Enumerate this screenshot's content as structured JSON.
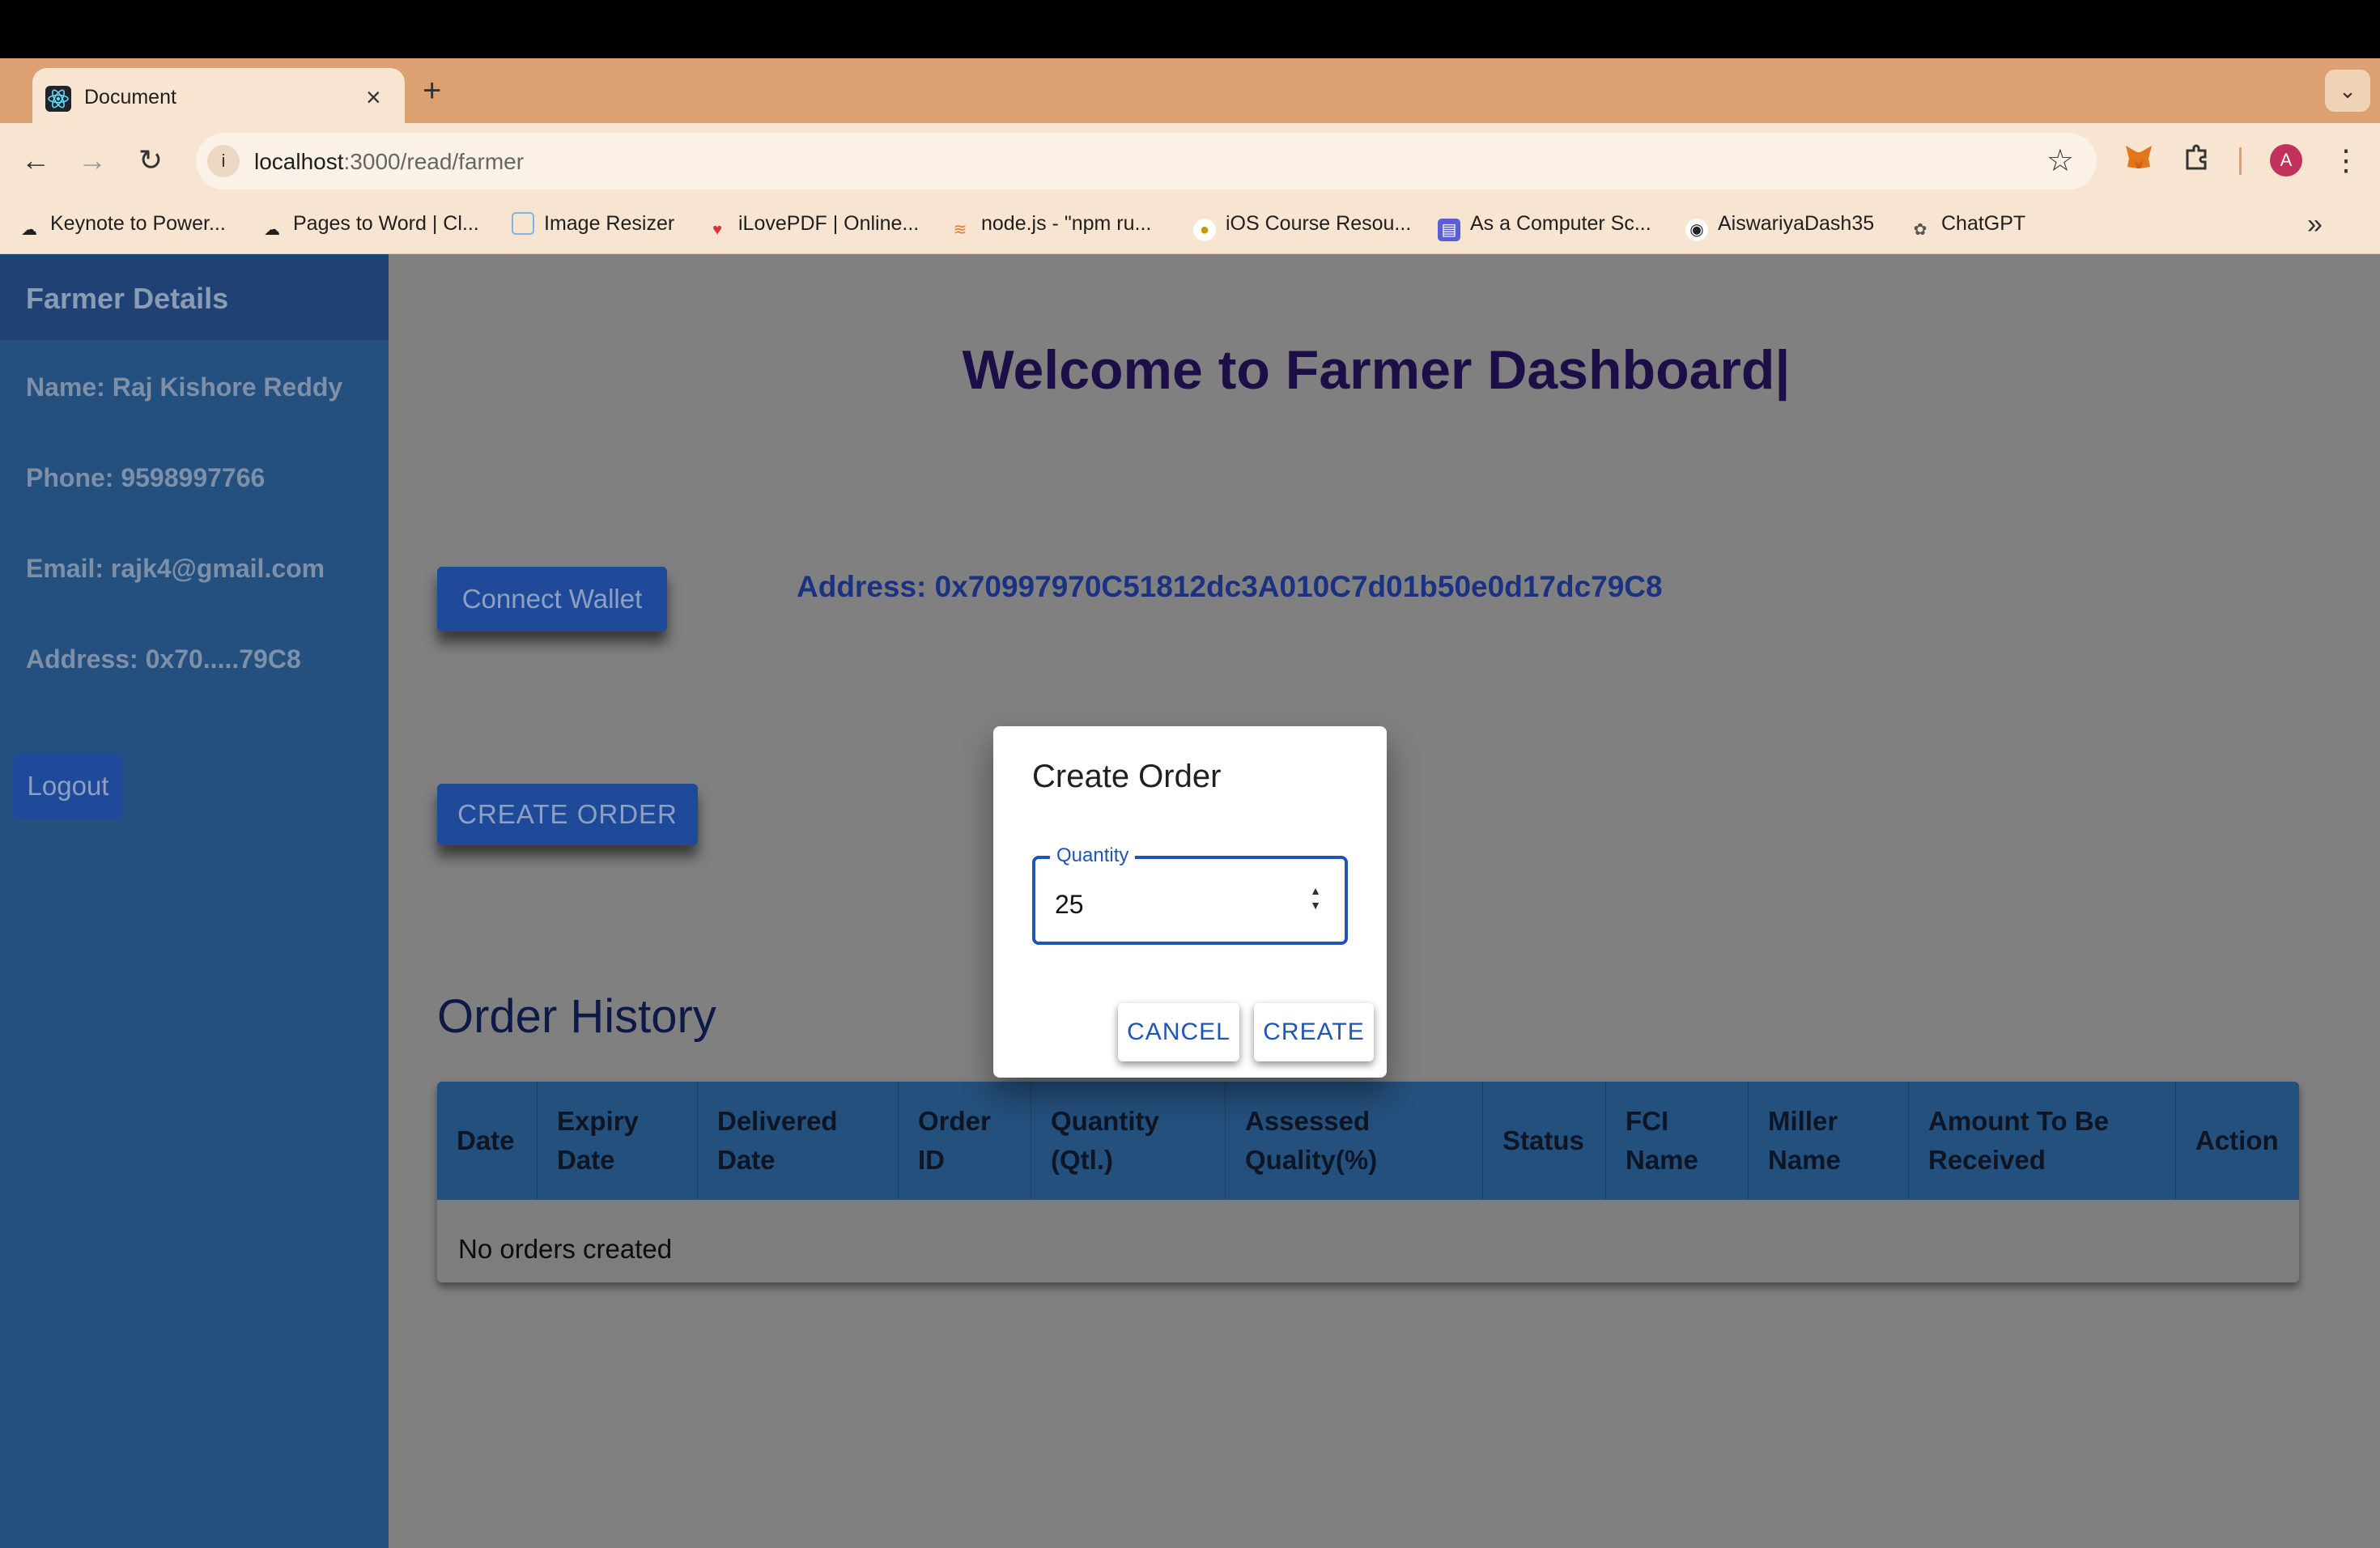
{
  "browser": {
    "tab_title": "Document",
    "url_host": "localhost",
    "url_path": ":3000/read/farmer",
    "bookmarks": [
      {
        "label": "Keynote to Power...",
        "icon": "cloud-icon"
      },
      {
        "label": "Pages to Word | Cl...",
        "icon": "cloud-icon"
      },
      {
        "label": "Image Resizer",
        "icon": "image-icon"
      },
      {
        "label": "iLovePDF | Online...",
        "icon": "heart-icon"
      },
      {
        "label": "node.js - \"npm ru...",
        "icon": "stackoverflow-icon"
      },
      {
        "label": "iOS Course Resou...",
        "icon": "course-icon"
      },
      {
        "label": "As a Computer Sc...",
        "icon": "printer-icon"
      },
      {
        "label": "AiswariyaDash35",
        "icon": "github-icon"
      },
      {
        "label": "ChatGPT",
        "icon": "chatgpt-icon"
      }
    ],
    "avatar_letter": "A"
  },
  "sidebar": {
    "title": "Farmer Details",
    "name": "Name: Raj Kishore Reddy",
    "phone": "Phone: 9598997766",
    "email": "Email: rajk4@gmail.com",
    "address": "Address: 0x70.....79C8",
    "logout_label": "Logout"
  },
  "main": {
    "title": "Welcome to Farmer Dashboard|",
    "connect_wallet_label": "Connect Wallet",
    "address": "Address: 0x70997970C51812dc3A010C7d01b50e0d17dc79C8",
    "create_order_label": "CREATE ORDER",
    "history_title": "Order History",
    "table": {
      "columns": [
        "Date",
        "Expiry Date",
        "Delivered Date",
        "Order ID",
        "Quantity (Qtl.)",
        "Assessed Quality(%)",
        "Status",
        "FCI Name",
        "Miller Name",
        "Amount To Be Received",
        "Action"
      ],
      "empty_message": "No orders created"
    }
  },
  "dialog": {
    "title": "Create Order",
    "quantity_label": "Quantity",
    "quantity_value": "25",
    "cancel_label": "CANCEL",
    "create_label": "CREATE"
  },
  "colors": {
    "sidebar": "#23507e",
    "backdrop": "#808080",
    "accent": "#1f55b8",
    "title": "#1d0e48"
  }
}
